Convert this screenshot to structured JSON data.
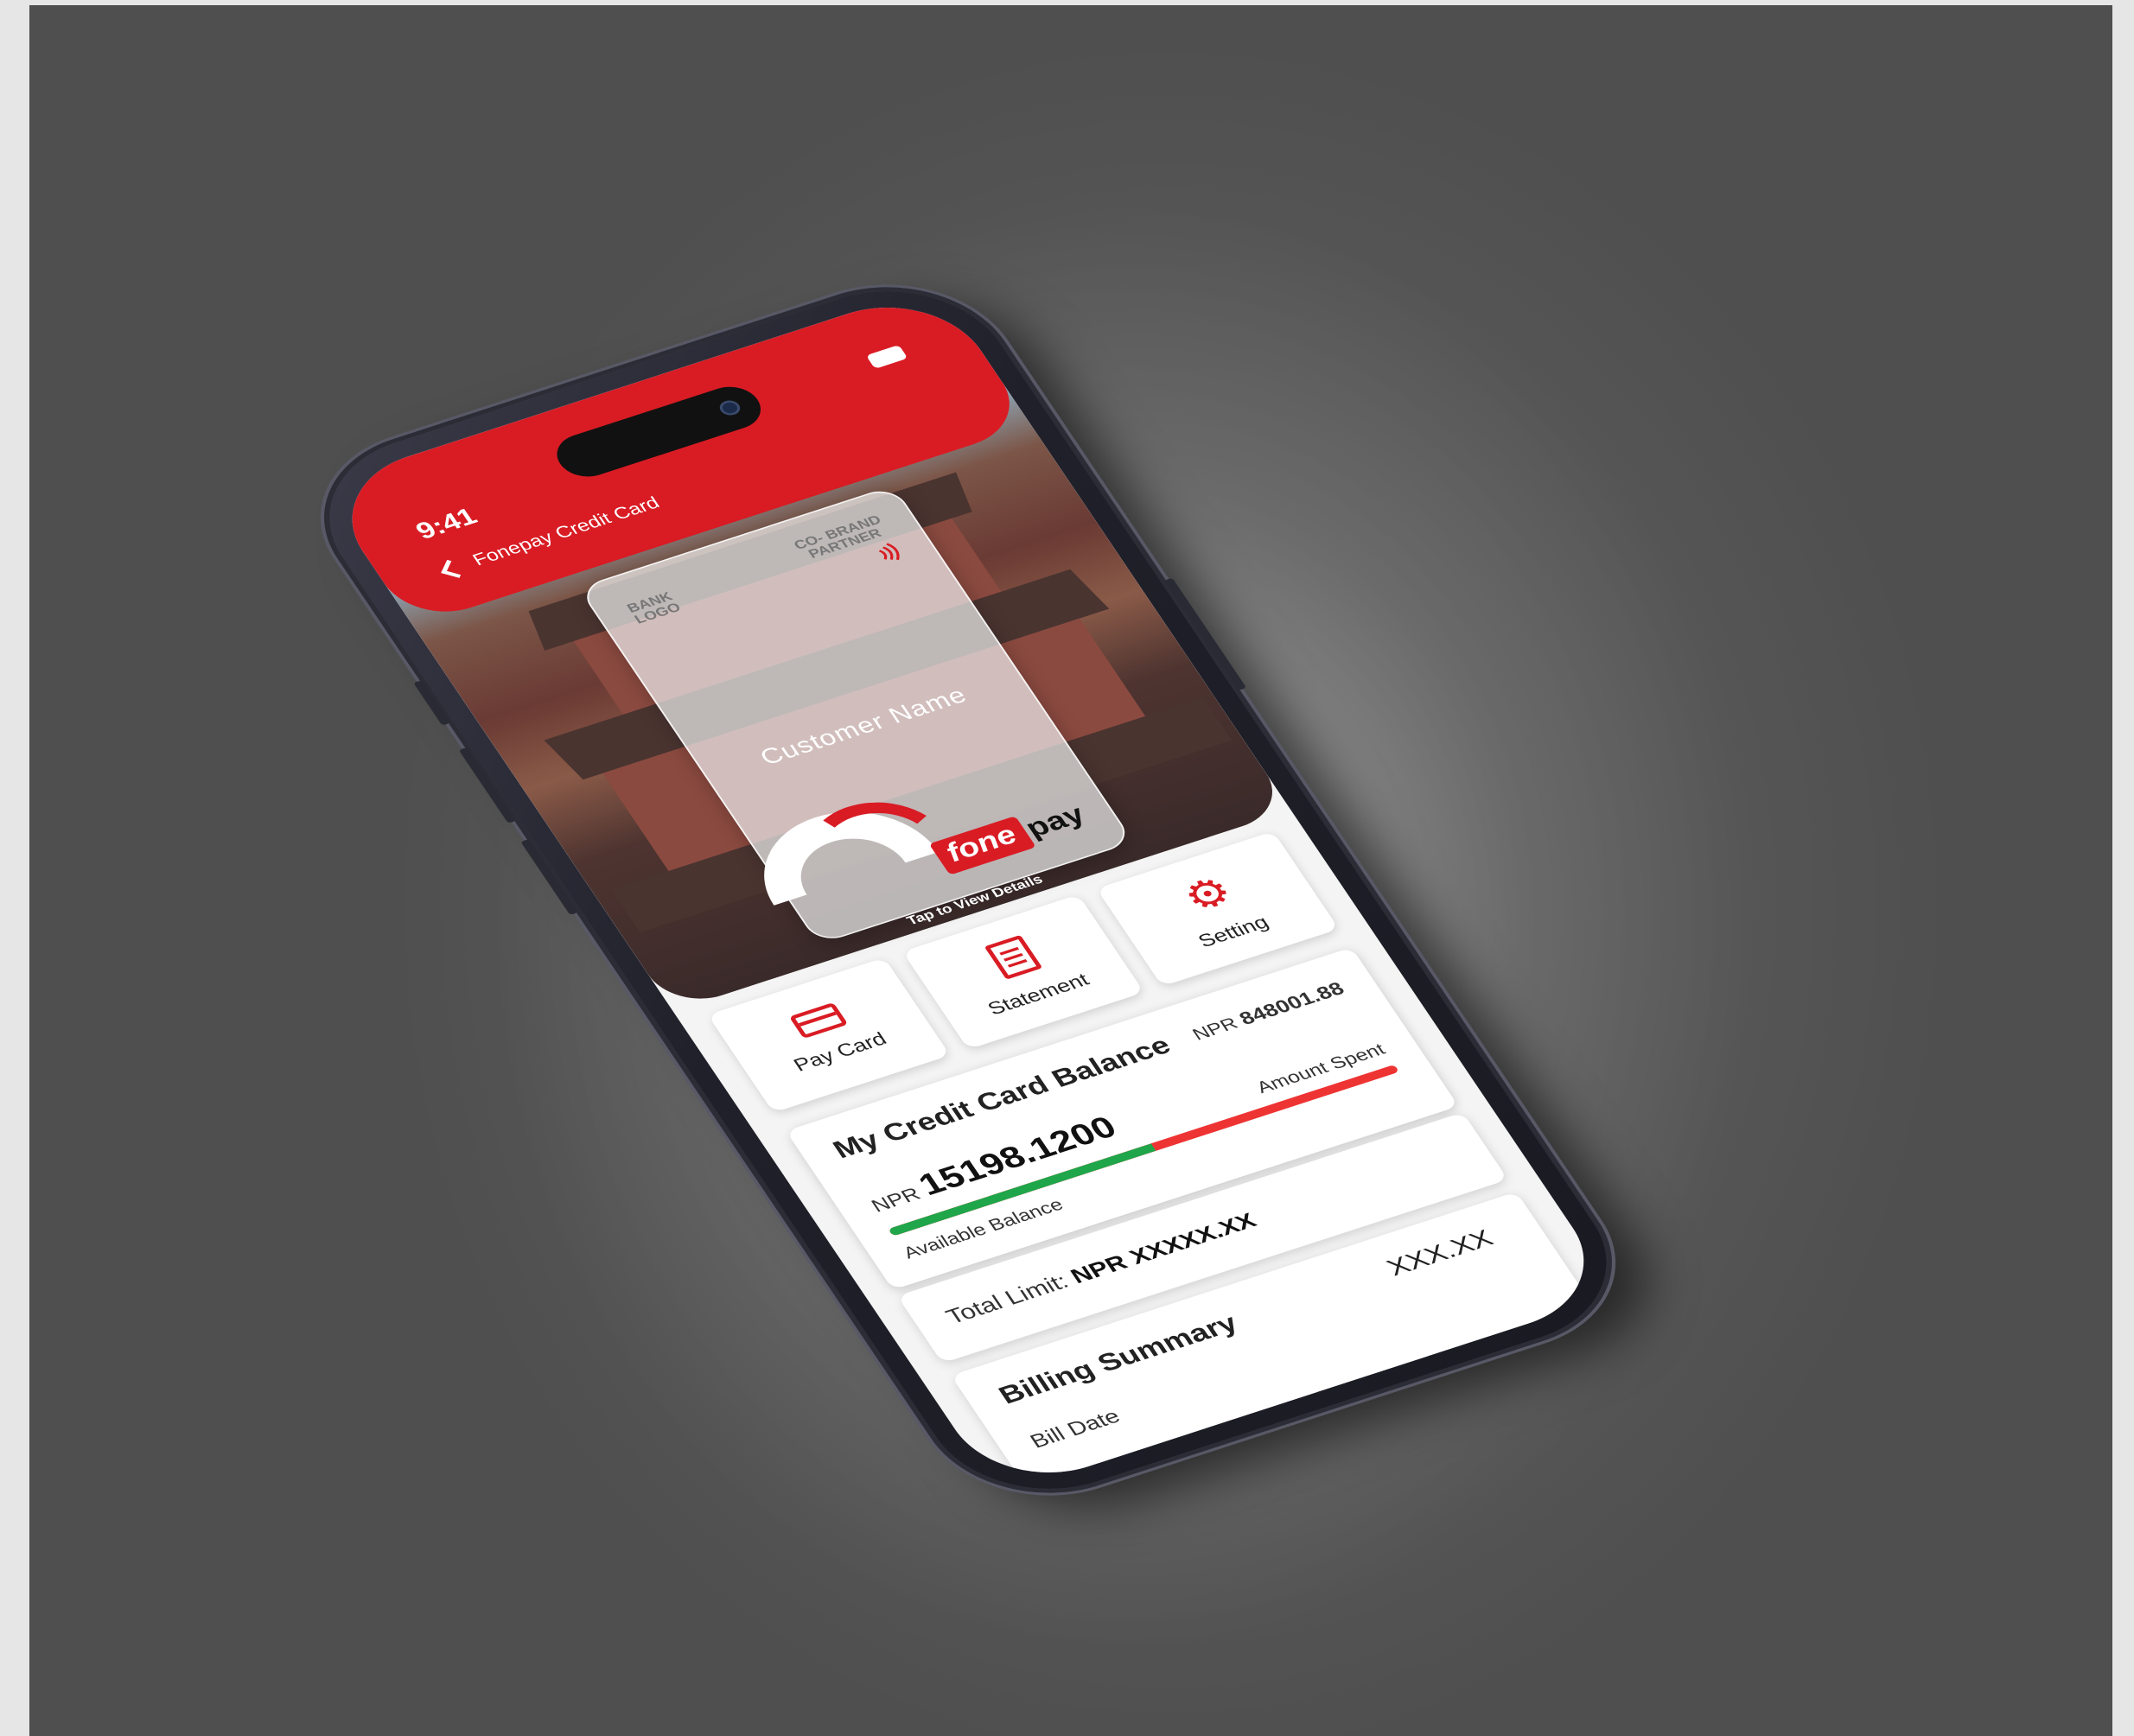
{
  "status_bar": {
    "time": "9:41"
  },
  "header": {
    "back_label": "Fonepay Credit Card"
  },
  "card": {
    "bank_logo": "BANK\nLOGO",
    "cobrand": "CO- BRAND\nPARTNER",
    "customer_name": "Customer Name",
    "brand_fone": "fone",
    "brand_pay": "pay",
    "tap_hint": "Tap to View Details"
  },
  "actions": [
    {
      "label": "Pay Card",
      "icon": "credit-card-icon"
    },
    {
      "label": "Statement",
      "icon": "document-icon"
    },
    {
      "label": "Setting",
      "icon": "gears-icon"
    }
  ],
  "balance": {
    "title": "My Credit Card Balance",
    "total_prefix": "NPR",
    "total_value": "848001.88",
    "available_prefix": "NPR",
    "available_value": "15198.1200",
    "available_label": "Available Balance",
    "spent_label": "Amount Spent",
    "available_fraction": 0.52
  },
  "limit": {
    "label": "Total Limit:",
    "value": "NPR XXXXX.XX"
  },
  "billing": {
    "title": "Billing Summary",
    "amount": "XXX.XX",
    "bill_date_label": "Bill Date"
  },
  "colors": {
    "brand_red": "#d91c24",
    "available_green": "#1fa64a",
    "spent_red": "#e33333"
  }
}
